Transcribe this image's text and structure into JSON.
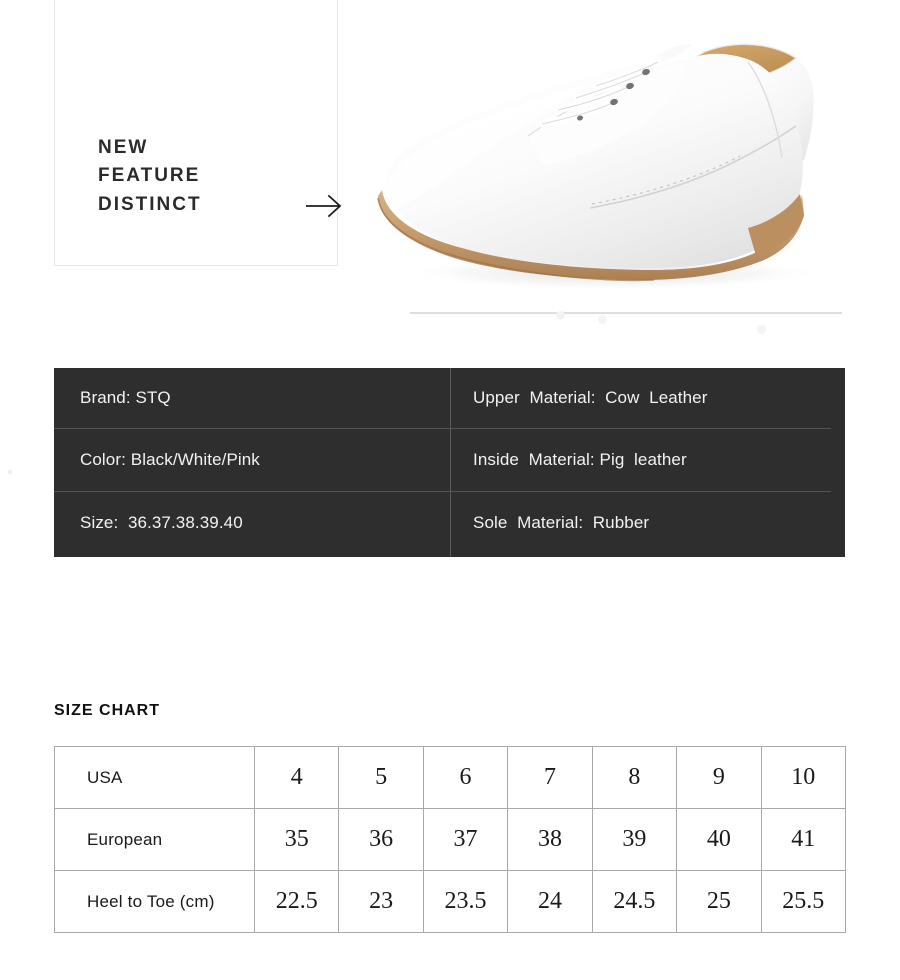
{
  "banner": {
    "headline_lines": [
      "NEW",
      "FEATURE",
      "DISTINCT"
    ],
    "headline_text": "NEW\nFEATURE\nDISTINCT",
    "arrow_icon": "arrow-right-icon",
    "product_image_alt": "white leather oxford flat shoe, side three-quarter view"
  },
  "spec": {
    "left": [
      "Brand: STQ",
      "Color: Black/White/Pink",
      "Size:  36.37.38.39.40"
    ],
    "right": [
      "Upper  Material:  Cow  Leather",
      "Inside  Material: Pig  leather",
      "Sole  Material:  Rubber"
    ],
    "background_color": "#2e2e2e",
    "text_color": "#f2f2f2",
    "divider_color": "#555555"
  },
  "size_chart": {
    "heading": "SIZE CHART",
    "rows": [
      {
        "label": "USA",
        "values": [
          "4",
          "5",
          "6",
          "7",
          "8",
          "9",
          "10"
        ]
      },
      {
        "label": "European",
        "values": [
          "35",
          "36",
          "37",
          "38",
          "39",
          "40",
          "41"
        ]
      },
      {
        "label": "Heel to Toe (cm)",
        "values": [
          "22.5",
          "23",
          "23.5",
          "24",
          "24.5",
          "25",
          "25.5"
        ]
      }
    ],
    "border_color": "#a8a8a8"
  }
}
